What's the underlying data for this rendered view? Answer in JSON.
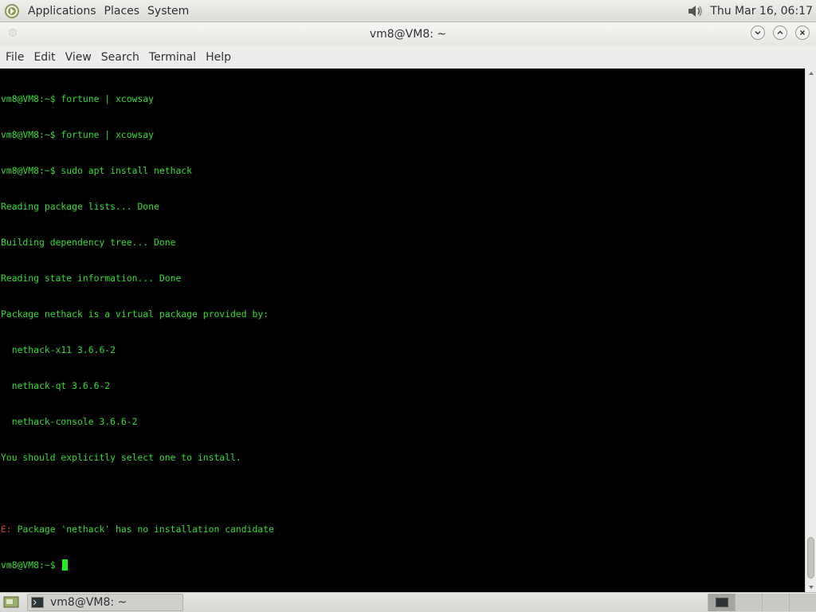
{
  "top_panel": {
    "menus": [
      "Applications",
      "Places",
      "System"
    ],
    "clock": "Thu Mar 16, 06:17",
    "icons": {
      "logo": "distro-logo-icon",
      "volume": "volume-icon"
    }
  },
  "window": {
    "title": "vm8@VM8: ~",
    "controls": [
      "minimize",
      "maximize",
      "close"
    ]
  },
  "menubar": {
    "items": [
      "File",
      "Edit",
      "View",
      "Search",
      "Terminal",
      "Help"
    ]
  },
  "terminal": {
    "lines": [
      "vm8@VM8:~$ fortune | xcowsay",
      "vm8@VM8:~$ fortune | xcowsay",
      "vm8@VM8:~$ sudo apt install nethack",
      "Reading package lists... Done",
      "Building dependency tree... Done",
      "Reading state information... Done",
      "Package nethack is a virtual package provided by:",
      "  nethack-x11 3.6.6-2",
      "  nethack-qt 3.6.6-2",
      "  nethack-console 3.6.6-2",
      "You should explicitly select one to install.",
      "",
      "Package 'nethack' has no installation candidate"
    ],
    "error_prefix": "E:",
    "prompt": "vm8@VM8:~$",
    "colors": {
      "fg": "#33dd33",
      "error": "#cc3333",
      "bg": "#000000"
    }
  },
  "taskbar": {
    "task_label": "vm8@VM8: ~",
    "workspaces": 4,
    "active_workspace": 1
  }
}
